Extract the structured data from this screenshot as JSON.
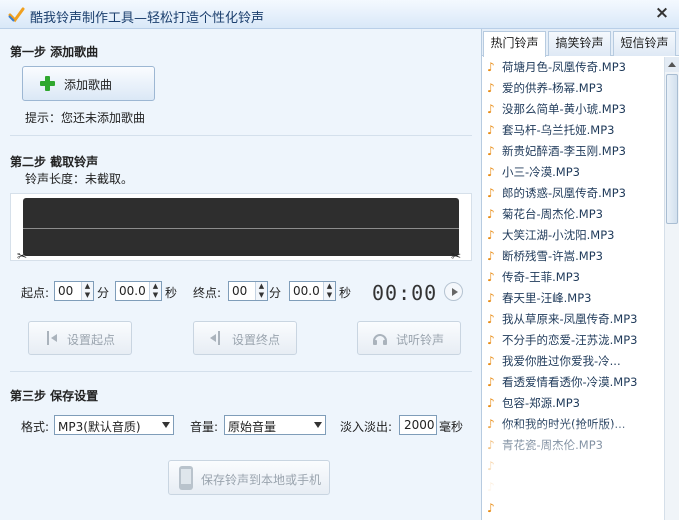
{
  "window": {
    "title": "酷我铃声制作工具—轻松打造个性化铃声",
    "close_glyph": "×"
  },
  "step1": {
    "title": "第一步  添加歌曲",
    "add_button": "添加歌曲",
    "tip": "提示：您还未添加歌曲"
  },
  "step2": {
    "title": "第二步  截取铃声",
    "length_text": "铃声长度：未截取。",
    "start_label": "起点:",
    "end_label": "终点:",
    "min_unit": "分",
    "sec_unit": "秒",
    "start_min": "00",
    "start_sec": "00.0",
    "end_min": "00",
    "end_sec": "00.0",
    "clock": "00:00",
    "set_start_button": "设置起点",
    "set_end_button": "设置终点",
    "preview_button": "试听铃声"
  },
  "step3": {
    "title": "第三步  保存设置",
    "format_label": "格式:",
    "format_value": "MP3(默认音质)",
    "volume_label": "音量:",
    "volume_value": "原始音量",
    "fade_label": "淡入淡出:",
    "fade_value": "2000",
    "fade_unit": "毫秒",
    "save_button": "保存铃声到本地或手机"
  },
  "tabs": [
    "热门铃声",
    "搞笑铃声",
    "短信铃声"
  ],
  "ringtones": [
    "荷塘月色-凤凰传奇.MP3",
    "爱的供养-杨幂.MP3",
    "没那么简单-黄小琥.MP3",
    "套马杆-乌兰托娅.MP3",
    "新贵妃醉酒-李玉刚.MP3",
    "小三-冷漠.MP3",
    "郎的诱惑-凤凰传奇.MP3",
    "菊花台-周杰伦.MP3",
    "大笑江湖-小沈阳.MP3",
    "断桥残雪-许嵩.MP3",
    "传奇-王菲.MP3",
    "春天里-汪峰.MP3",
    "我从草原来-凤凰传奇.MP3",
    "不分手的恋爱-汪苏泷.MP3",
    "我爱你胜过你爱我-冷...",
    "看透爱情看透你-冷漠.MP3",
    "包容-郑源.MP3",
    "你和我的时光(抢听版)...",
    "青花瓷-周杰伦.MP3",
    "",
    "",
    ""
  ],
  "colors": {
    "accent": "#1b3f6e",
    "note": "#e88a10"
  }
}
